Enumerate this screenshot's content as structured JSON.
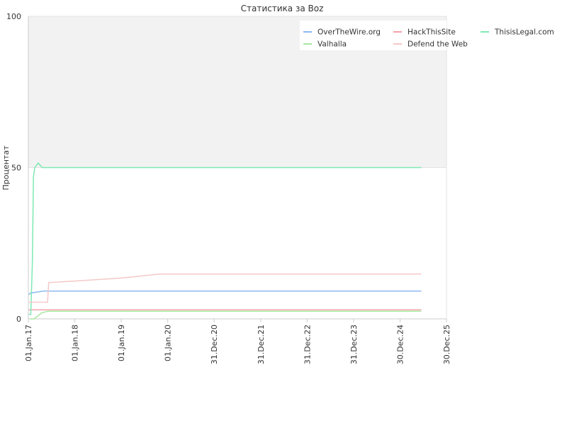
{
  "chart_data": {
    "type": "line",
    "title": "Статистика за Boz",
    "ylabel": "Процентат",
    "xlabel": "",
    "ylim": [
      0,
      100
    ],
    "yticks": [
      0,
      50,
      100
    ],
    "xlim": [
      "2017-01-01",
      "2025-12-30"
    ],
    "xticks": [
      {
        "date": "2017-01-01",
        "label": "01.Jan.17"
      },
      {
        "date": "2018-01-01",
        "label": "01.Jan.18"
      },
      {
        "date": "2019-01-01",
        "label": "01.Jan.19"
      },
      {
        "date": "2020-01-01",
        "label": "01.Jan.20"
      },
      {
        "date": "2020-12-31",
        "label": "31.Dec.20"
      },
      {
        "date": "2021-12-31",
        "label": "31.Dec.21"
      },
      {
        "date": "2022-12-31",
        "label": "31.Dec.22"
      },
      {
        "date": "2023-12-31",
        "label": "31.Dec.23"
      },
      {
        "date": "2024-12-30",
        "label": "30.Dec.24"
      },
      {
        "date": "2025-12-30",
        "label": "30.Dec.25"
      }
    ],
    "grid": "horizontal",
    "shaded_band": [
      50,
      100
    ],
    "legend_position": "top-right",
    "series": [
      {
        "name": "OverTheWire.org",
        "color": "#8cb8f0",
        "points": [
          [
            "2017-01-05",
            8
          ],
          [
            "2017-01-15",
            8.5
          ],
          [
            "2017-03-01",
            8.8
          ],
          [
            "2017-05-01",
            9.2
          ],
          [
            "2025-06-15",
            9.2
          ]
        ]
      },
      {
        "name": "HackThisSite",
        "color": "#f5a0a8",
        "points": [
          [
            "2017-01-05",
            3
          ],
          [
            "2025-06-15",
            3
          ]
        ]
      },
      {
        "name": "ThisisLegal.com",
        "color": "#7ee8b4",
        "points": [
          [
            "2017-01-05",
            1.5
          ],
          [
            "2017-01-20",
            1.5
          ],
          [
            "2017-02-01",
            18
          ],
          [
            "2017-02-10",
            47
          ],
          [
            "2017-02-20",
            50
          ],
          [
            "2017-03-20",
            51.5
          ],
          [
            "2017-04-20",
            50
          ],
          [
            "2025-06-15",
            50
          ]
        ]
      },
      {
        "name": "Valhalla",
        "color": "#a8e8a0",
        "points": [
          [
            "2017-01-15",
            0
          ],
          [
            "2017-02-15",
            0
          ],
          [
            "2017-04-15",
            2
          ],
          [
            "2017-06-01",
            2.5
          ],
          [
            "2025-06-15",
            2.5
          ]
        ]
      },
      {
        "name": "Defend the Web",
        "color": "#f5c8c8",
        "points": [
          [
            "2017-01-05",
            5.5
          ],
          [
            "2017-06-01",
            5.5
          ],
          [
            "2017-06-10",
            12
          ],
          [
            "2018-01-01",
            12.5
          ],
          [
            "2019-01-01",
            13.5
          ],
          [
            "2019-11-01",
            14.8
          ],
          [
            "2025-06-15",
            14.8
          ]
        ]
      }
    ]
  }
}
